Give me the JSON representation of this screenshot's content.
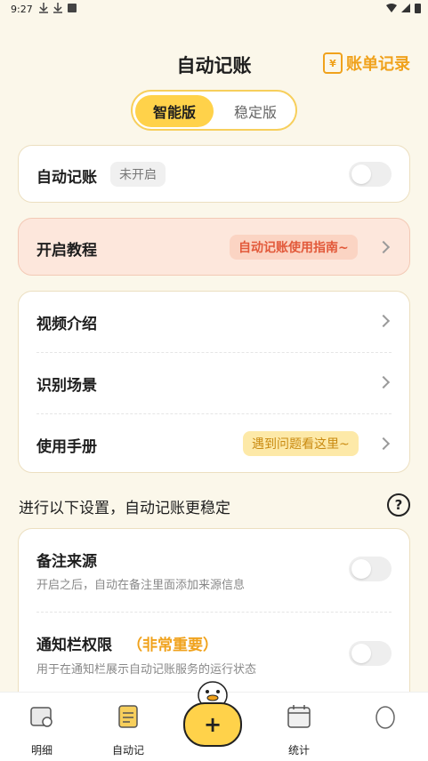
{
  "status": {
    "time": "9:27"
  },
  "header": {
    "title": "自动记账",
    "bill_record": "账单记录",
    "bill_icon_symbol": "¥"
  },
  "segment": {
    "options": [
      "智能版",
      "稳定版"
    ],
    "selected": "智能版"
  },
  "auto_card": {
    "label": "自动记账",
    "status_badge": "未开启",
    "toggle_on": false
  },
  "tutorial": {
    "label": "开启教程",
    "guide": "自动记账使用指南~"
  },
  "menu": {
    "items": [
      {
        "label": "视频介绍"
      },
      {
        "label": "识别场景"
      },
      {
        "label": "使用手册",
        "tag": "遇到问题看这里~"
      }
    ]
  },
  "settings_section": {
    "text": "进行以下设置，自动记账更稳定",
    "help_symbol": "?"
  },
  "settings": {
    "items": [
      {
        "label": "备注来源",
        "desc": "开启之后，自动在备注里面添加来源信息",
        "toggle_on": false
      },
      {
        "label": "通知栏权限",
        "highlight": "（非常重要）",
        "desc": "用于在通知栏展示自动记账服务的运行状态",
        "toggle_on": false
      }
    ]
  },
  "nav": {
    "items": [
      {
        "label": "明细",
        "icon": "ledger-icon"
      },
      {
        "label": "自动记",
        "icon": "auto-note-icon"
      },
      {
        "label": "统计",
        "icon": "calendar-icon"
      },
      {
        "label": "",
        "icon": "egg-icon"
      }
    ],
    "add_symbol": "+"
  },
  "colors": {
    "accent": "#ffd24a",
    "orange": "#f0a21c",
    "red": "#e2593a",
    "background": "#fbf7ea"
  }
}
